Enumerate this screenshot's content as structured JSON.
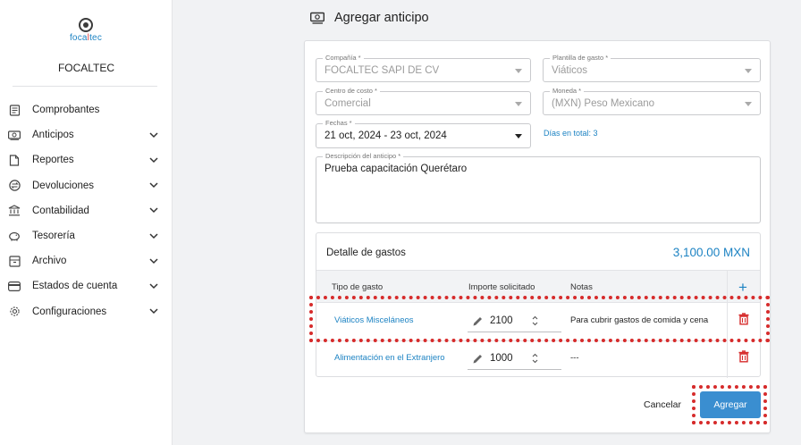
{
  "sidebar": {
    "logo": {
      "prefix": "foca",
      "accent": "l",
      "suffix": "tec"
    },
    "company": "FOCALTEC",
    "items": [
      {
        "label": "Comprobantes",
        "icon": "document-list-icon",
        "has_children": false
      },
      {
        "label": "Anticipos",
        "icon": "cash-icon",
        "has_children": true
      },
      {
        "label": "Reportes",
        "icon": "report-icon",
        "has_children": true
      },
      {
        "label": "Devoluciones",
        "icon": "exchange-icon",
        "has_children": true
      },
      {
        "label": "Contabilidad",
        "icon": "bank-icon",
        "has_children": true
      },
      {
        "label": "Tesorería",
        "icon": "piggy-bank-icon",
        "has_children": true
      },
      {
        "label": "Archivo",
        "icon": "archive-icon",
        "has_children": true
      },
      {
        "label": "Estados de cuenta",
        "icon": "card-icon",
        "has_children": true
      },
      {
        "label": "Configuraciones",
        "icon": "gear-icon",
        "has_children": true
      }
    ]
  },
  "header": {
    "title": "Agregar anticipo",
    "icon": "cash-icon"
  },
  "form": {
    "compania": {
      "label": "Compañía *",
      "value": "FOCALTEC SAPI DE CV"
    },
    "plantilla": {
      "label": "Plantilla de gasto *",
      "value": "Viáticos"
    },
    "centro": {
      "label": "Centro de costo *",
      "value": "Comercial"
    },
    "moneda": {
      "label": "Moneda *",
      "value": "(MXN) Peso Mexicano"
    },
    "fechas": {
      "label": "Fechas *",
      "value": "21 oct, 2024 - 23 oct, 2024"
    },
    "dias": "Días en total: 3",
    "descripcion": {
      "label": "Descripción del anticipo *",
      "value": "Prueba capacitación Querétaro"
    }
  },
  "detalle": {
    "title": "Detalle de gastos",
    "total": "3,100.00 MXN",
    "columns": [
      "Tipo de gasto",
      "Importe solicitado",
      "Notas"
    ],
    "rows": [
      {
        "tipo": "Viáticos Misceláneos",
        "importe": "2100",
        "notas": "Para cubrir gastos de comida y cena"
      },
      {
        "tipo": "Alimentación en el Extranjero",
        "importe": "1000",
        "notas": "---"
      }
    ]
  },
  "actions": {
    "cancel": "Cancelar",
    "add": "Agregar"
  },
  "colors": {
    "accent": "#1d83c3",
    "button": "#3a8ed0",
    "danger": "#d62b2b",
    "highlight": "#d62b2b"
  }
}
